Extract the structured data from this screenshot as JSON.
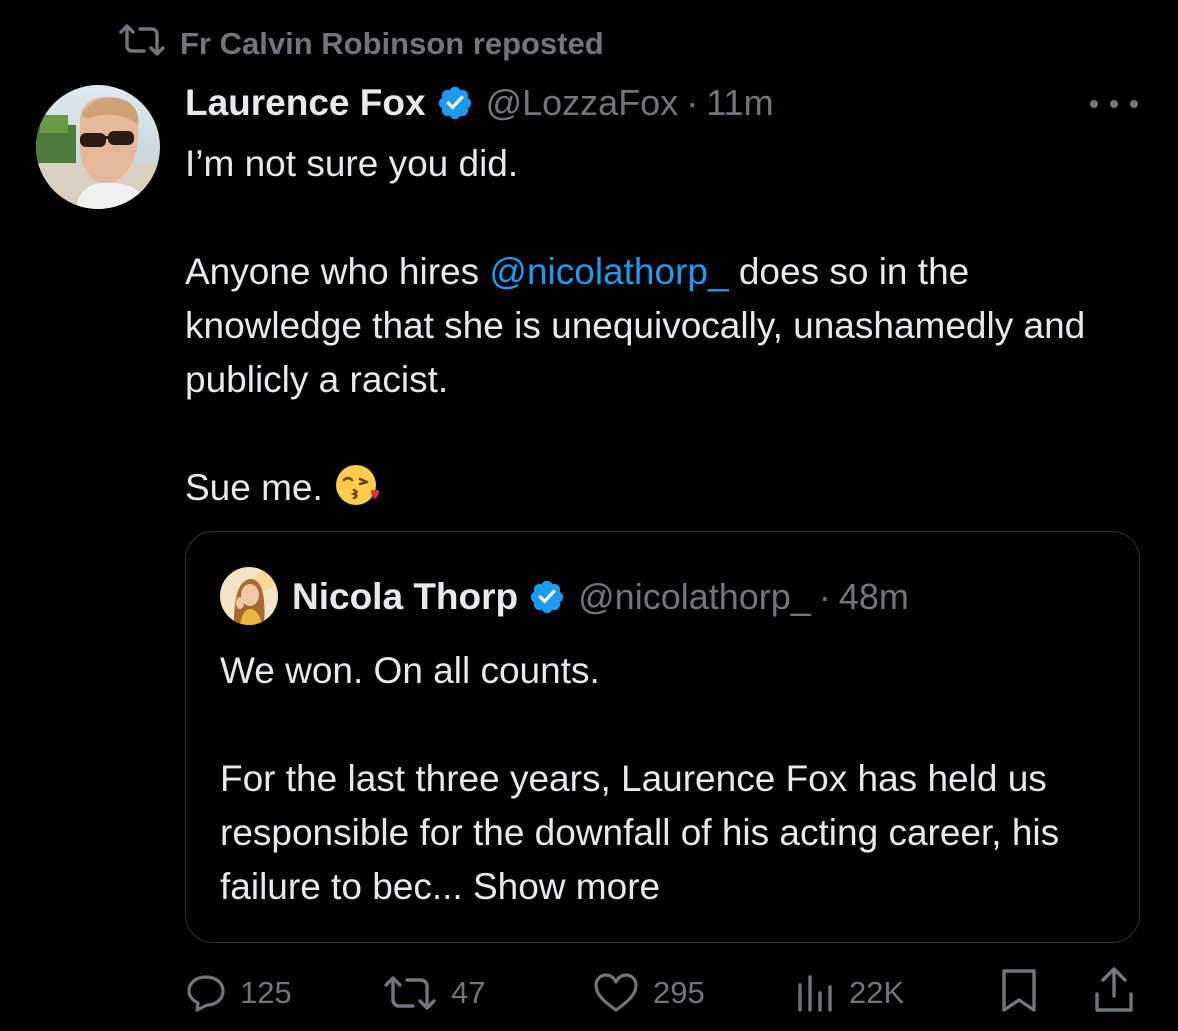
{
  "repost": {
    "icon": "repost-icon",
    "text": "Fr Calvin Robinson reposted"
  },
  "tweet": {
    "author_name": "Laurence Fox",
    "handle": "@LozzaFox",
    "separator": "·",
    "timestamp": "11m",
    "line1": "I’m not sure you did.",
    "line2_before": "Anyone who hires ",
    "mention": "@nicolathorp_",
    "line2_after": " does so in the knowledge that she is unequivocally, unashamedly and publicly a racist.",
    "line3": "Sue me.",
    "emoji": "face-blowing-kiss-emoji"
  },
  "quote": {
    "author_name": "Nicola Thorp",
    "handle": "@nicolathorp_",
    "separator": "·",
    "timestamp": "48m",
    "line1": "We won. On all counts.",
    "line2": "For the last three years, Laurence Fox has held us responsible for the downfall of his acting career, his failure to bec... Show more"
  },
  "actions": {
    "replies": "125",
    "reposts": "47",
    "likes": "295",
    "views": "22K"
  },
  "colors": {
    "background": "#000000",
    "text": "#e7e9ea",
    "muted": "#71767b",
    "accent": "#1d9bf0",
    "border": "#2f3336"
  }
}
